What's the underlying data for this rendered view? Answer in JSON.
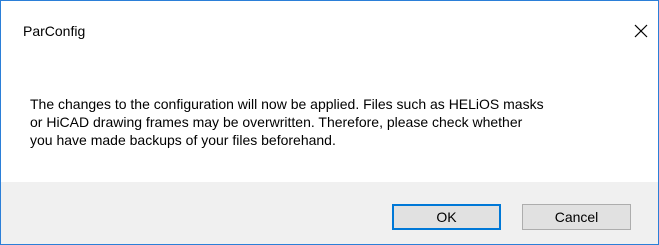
{
  "window": {
    "title": "ParConfig",
    "close_icon": "close-icon"
  },
  "message": {
    "text": "The changes to the configuration will now be applied. Files such as HELiOS masks\nor HiCAD drawing frames may be overwritten. Therefore, please check whether\nyou have made backups of your files beforehand."
  },
  "buttons": {
    "ok_label": "OK",
    "cancel_label": "Cancel"
  },
  "colors": {
    "window_border": "#2b7fd8",
    "footer_background": "#f0f0f0",
    "default_button_border": "#0078d7"
  }
}
